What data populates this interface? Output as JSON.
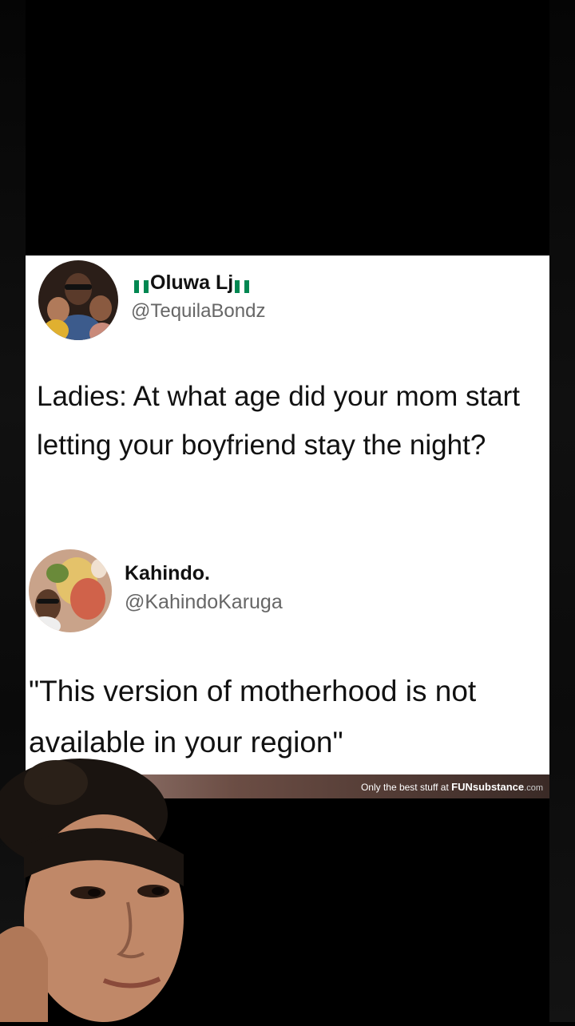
{
  "tweet": {
    "author_name": "Oluwa Lj",
    "author_handle": "@TequilaBondz",
    "text": "Ladies: At what age did your mom start letting your boyfriend stay the night?"
  },
  "reply": {
    "author_name": "Kahindo.",
    "author_handle": "@KahindoKaruga",
    "text": "\"This version of motherhood is not available in your region\""
  },
  "footer": {
    "prefix": "Only the best stuff at",
    "brand_bold": "FUN",
    "brand_rest": "substance",
    "domain": ".com"
  },
  "colors": {
    "flag_green": "#008751",
    "flag_white": "#ffffff",
    "footer_brown": "#6b4d44"
  }
}
